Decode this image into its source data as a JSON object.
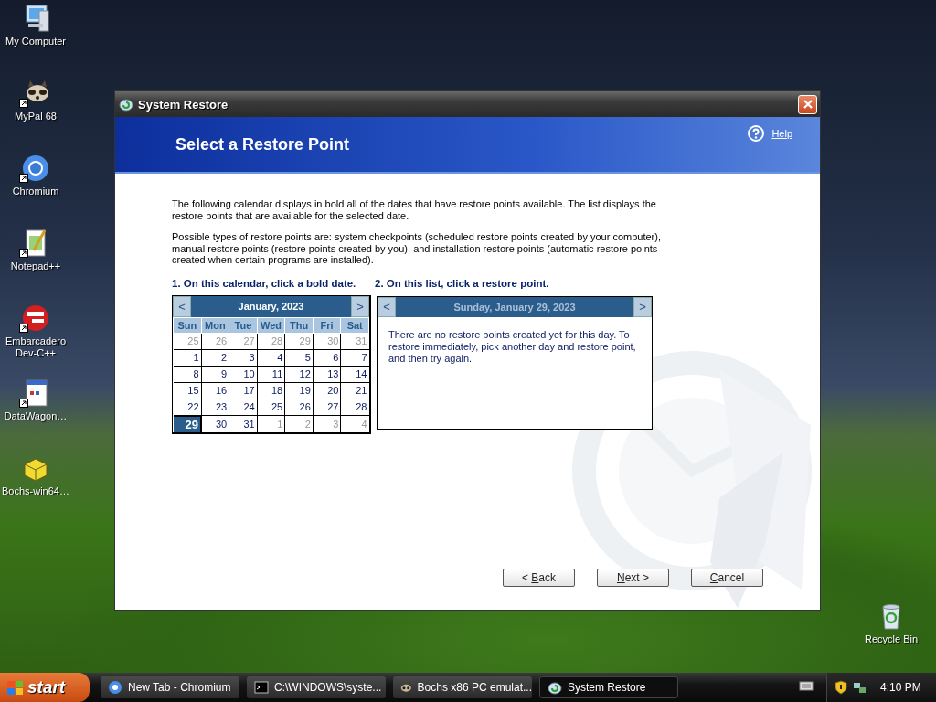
{
  "desktop_icons": [
    {
      "label": "My Computer",
      "kind": "computer"
    },
    {
      "label": "MyPal 68",
      "kind": "raccoon"
    },
    {
      "label": "Chromium",
      "kind": "chromium"
    },
    {
      "label": "Notepad++",
      "kind": "notepad"
    },
    {
      "label": "Embarcadero Dev-C++",
      "kind": "devcpp"
    },
    {
      "label": "DataWagon…",
      "kind": "document"
    },
    {
      "label": "Bochs-win64…",
      "kind": "box"
    },
    {
      "label": "Recycle Bin",
      "kind": "recycle"
    }
  ],
  "window": {
    "title": "System Restore",
    "header": "Select a Restore Point",
    "help": "Help",
    "intro": [
      "The following calendar displays in bold all of the dates that have restore points available. The list displays the restore points that are available for the selected date.",
      "Possible types of restore points are: system checkpoints (scheduled restore points created by your computer), manual restore points (restore points created by you), and installation restore points (automatic restore points created when certain programs are installed)."
    ],
    "step_1": "1. On this calendar, click a bold date.",
    "step_2": "2. On this list, click a restore point.",
    "calendar": {
      "prev": "<",
      "next": ">",
      "month": "January, 2023",
      "weekdays": [
        "Sun",
        "Mon",
        "Tue",
        "Wed",
        "Thu",
        "Fri",
        "Sat"
      ],
      "weeks": [
        [
          {
            "day": "25",
            "other_month": true,
            "selected": false
          },
          {
            "day": "26",
            "other_month": true,
            "selected": false
          },
          {
            "day": "27",
            "other_month": true,
            "selected": false
          },
          {
            "day": "28",
            "other_month": true,
            "selected": false
          },
          {
            "day": "29",
            "other_month": true,
            "selected": false
          },
          {
            "day": "30",
            "other_month": true,
            "selected": false
          },
          {
            "day": "31",
            "other_month": true,
            "selected": false
          }
        ],
        [
          {
            "day": "1",
            "other_month": false,
            "selected": false
          },
          {
            "day": "2",
            "other_month": false,
            "selected": false
          },
          {
            "day": "3",
            "other_month": false,
            "selected": false
          },
          {
            "day": "4",
            "other_month": false,
            "selected": false
          },
          {
            "day": "5",
            "other_month": false,
            "selected": false
          },
          {
            "day": "6",
            "other_month": false,
            "selected": false
          },
          {
            "day": "7",
            "other_month": false,
            "selected": false
          }
        ],
        [
          {
            "day": "8",
            "other_month": false,
            "selected": false
          },
          {
            "day": "9",
            "other_month": false,
            "selected": false
          },
          {
            "day": "10",
            "other_month": false,
            "selected": false
          },
          {
            "day": "11",
            "other_month": false,
            "selected": false
          },
          {
            "day": "12",
            "other_month": false,
            "selected": false
          },
          {
            "day": "13",
            "other_month": false,
            "selected": false
          },
          {
            "day": "14",
            "other_month": false,
            "selected": false
          }
        ],
        [
          {
            "day": "15",
            "other_month": false,
            "selected": false
          },
          {
            "day": "16",
            "other_month": false,
            "selected": false
          },
          {
            "day": "17",
            "other_month": false,
            "selected": false
          },
          {
            "day": "18",
            "other_month": false,
            "selected": false
          },
          {
            "day": "19",
            "other_month": false,
            "selected": false
          },
          {
            "day": "20",
            "other_month": false,
            "selected": false
          },
          {
            "day": "21",
            "other_month": false,
            "selected": false
          }
        ],
        [
          {
            "day": "22",
            "other_month": false,
            "selected": false
          },
          {
            "day": "23",
            "other_month": false,
            "selected": false
          },
          {
            "day": "24",
            "other_month": false,
            "selected": false
          },
          {
            "day": "25",
            "other_month": false,
            "selected": false
          },
          {
            "day": "26",
            "other_month": false,
            "selected": false
          },
          {
            "day": "27",
            "other_month": false,
            "selected": false
          },
          {
            "day": "28",
            "other_month": false,
            "selected": false
          }
        ],
        [
          {
            "day": "29",
            "other_month": false,
            "selected": true
          },
          {
            "day": "30",
            "other_month": false,
            "selected": false
          },
          {
            "day": "31",
            "other_month": false,
            "selected": false
          },
          {
            "day": "1",
            "other_month": true,
            "selected": false
          },
          {
            "day": "2",
            "other_month": true,
            "selected": false
          },
          {
            "day": "3",
            "other_month": true,
            "selected": false
          },
          {
            "day": "4",
            "other_month": true,
            "selected": false
          }
        ]
      ]
    },
    "list": {
      "prev": "<",
      "next": ">",
      "date": "Sunday, January 29, 2023",
      "message": "There are no restore points created yet for this day. To restore immediately, pick another day and restore point, and then try again."
    },
    "buttons": [
      {
        "before": "< ",
        "key": "B",
        "after": "ack"
      },
      {
        "key": "N",
        "after": "ext >"
      },
      {
        "key": "C",
        "after": "ancel"
      }
    ]
  },
  "taskbar": {
    "start": "start",
    "tasks": [
      {
        "label": "New Tab - Chromium",
        "kind": "chromium",
        "selected": false
      },
      {
        "label": "C:\\WINDOWS\\syste...",
        "kind": "console",
        "selected": false
      },
      {
        "label": "Bochs x86 PC emulat...",
        "kind": "bochs",
        "selected": false
      },
      {
        "label": "System Restore",
        "kind": "restore",
        "selected": true
      }
    ],
    "clock": "4:10 PM"
  }
}
